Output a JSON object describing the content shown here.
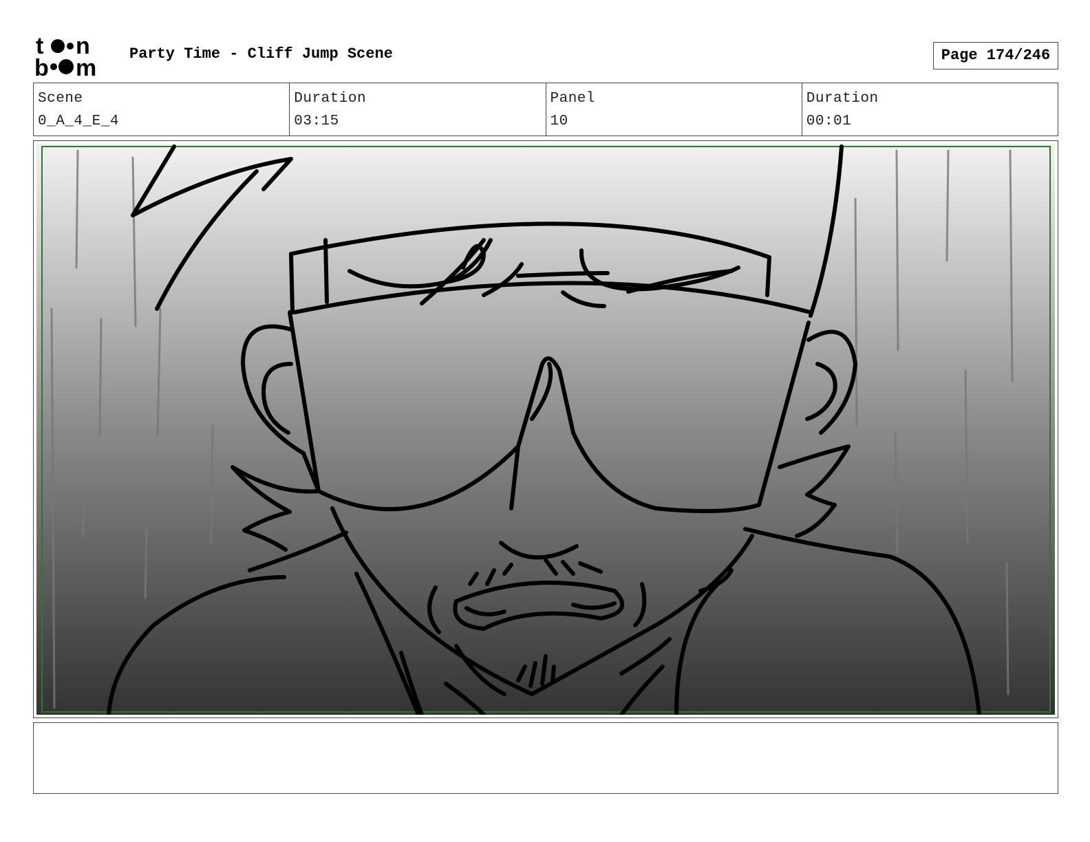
{
  "header": {
    "logo_text": "toonboom",
    "title": "Party Time - Cliff Jump Scene",
    "page_label": "Page 174/246"
  },
  "info": {
    "scene_label": "Scene",
    "scene_value": "0_A_4_E_4",
    "scene_duration_label": "Duration",
    "scene_duration_value": "03:15",
    "panel_label": "Panel",
    "panel_value": "10",
    "panel_duration_label": "Duration",
    "panel_duration_value": "00:01"
  },
  "panel": {
    "sketch": "storyboard-sketch",
    "gradient_top": "#f2f2f2",
    "gradient_bottom": "#333333",
    "frame_color": "#2a7a2a"
  },
  "notes": {
    "text": ""
  }
}
